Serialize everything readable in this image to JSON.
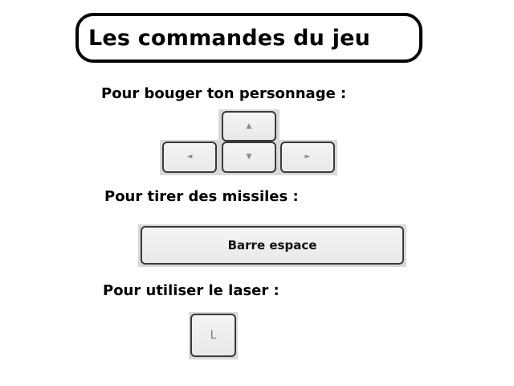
{
  "title": "Les commandes du jeu",
  "sections": {
    "move": {
      "label": "Pour bouger ton personnage :",
      "keys": {
        "up_icon": "arrow-up-icon",
        "down_icon": "arrow-down-icon",
        "left_icon": "arrow-left-icon",
        "right_icon": "arrow-right-icon",
        "up_glyph": "▲",
        "down_glyph": "▼",
        "left_glyph": "◄",
        "right_glyph": "►"
      }
    },
    "missiles": {
      "label": "Pour tirer des missiles :",
      "key_label": "Barre espace"
    },
    "laser": {
      "label": "Pour utiliser le laser :",
      "key_label": "L"
    }
  },
  "colors": {
    "key_border": "#3a3a3a",
    "key_face": "#f0f0f0",
    "key_shadow": "#d9d9d9",
    "glyph": "#8a8a8a"
  }
}
